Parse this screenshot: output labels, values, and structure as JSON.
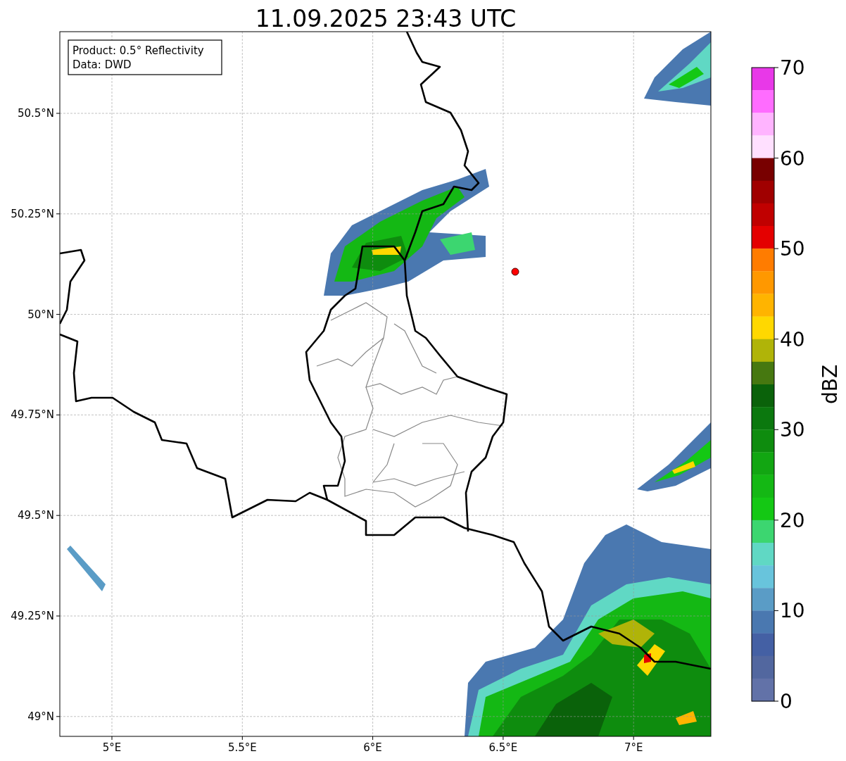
{
  "title": "11.09.2025 23:43 UTC",
  "legend": [
    "Product: 0.5° Reflectivity",
    "Data: DWD"
  ],
  "lat_labels": [
    "50.5°N",
    "50.25°N",
    "50°N",
    "49.75°N",
    "49.5°N",
    "49.25°N",
    "49°N"
  ],
  "lon_labels": [
    "5°E",
    "5.5°E",
    "6°E",
    "6.5°E",
    "7°E"
  ],
  "colorbar": {
    "label": "dBZ",
    "ticks": [
      "70",
      "60",
      "50",
      "40",
      "30",
      "20",
      "10",
      "0"
    ],
    "bins": [
      {
        "color": "#e838e8"
      },
      {
        "color": "#ff6cff"
      },
      {
        "color": "#ffb4ff"
      },
      {
        "color": "#ffe0ff"
      },
      {
        "color": "#780000"
      },
      {
        "color": "#a00000"
      },
      {
        "color": "#c00000"
      },
      {
        "color": "#e40000"
      },
      {
        "color": "#ff7c00"
      },
      {
        "color": "#ff9800"
      },
      {
        "color": "#ffb400"
      },
      {
        "color": "#ffd800"
      },
      {
        "color": "#b0b408"
      },
      {
        "color": "#467810"
      },
      {
        "color": "#0a620a"
      },
      {
        "color": "#0b780e"
      },
      {
        "color": "#0e8c0e"
      },
      {
        "color": "#12a612"
      },
      {
        "color": "#14b814"
      },
      {
        "color": "#14c814"
      },
      {
        "color": "#3cd670"
      },
      {
        "color": "#60d8c4"
      },
      {
        "color": "#68c4dc"
      },
      {
        "color": "#5a9cc6"
      },
      {
        "color": "#4a78b0"
      },
      {
        "color": "#4460a4"
      },
      {
        "color": "#52679f"
      },
      {
        "color": "#6272a8"
      }
    ]
  }
}
